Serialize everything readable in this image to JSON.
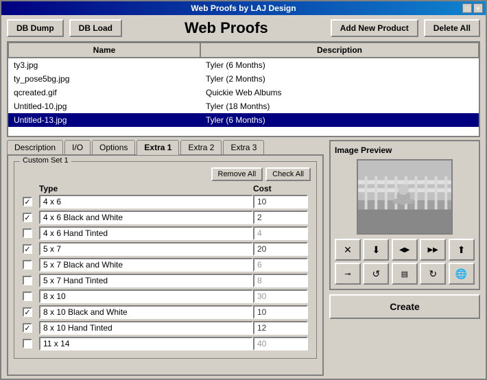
{
  "window": {
    "title": "Web Proofs by LAJ Design",
    "title_btn1": "□",
    "title_btn2": "×"
  },
  "toolbar": {
    "db_dump_label": "DB Dump",
    "db_load_label": "DB Load",
    "title": "Web Proofs",
    "add_new_product_label": "Add New Product",
    "delete_all_label": "Delete All"
  },
  "table": {
    "col_name": "Name",
    "col_description": "Description",
    "rows": [
      {
        "name": "ty3.jpg",
        "description": "Tyler (6 Months)",
        "selected": false
      },
      {
        "name": "ty_pose5bg.jpg",
        "description": "Tyler (2 Months)",
        "selected": false
      },
      {
        "name": "qcreated.gif",
        "description": "Quickie Web Albums",
        "selected": false
      },
      {
        "name": "Untitled-10.jpg",
        "description": "Tyler (18 Months)",
        "selected": false
      },
      {
        "name": "Untitled-13.jpg",
        "description": "Tyler (6 Months)",
        "selected": true
      }
    ]
  },
  "tabs": {
    "items": [
      "Description",
      "I/O",
      "Options",
      "Extra 1",
      "Extra 2",
      "Extra 3"
    ],
    "active": "Extra 1"
  },
  "panel": {
    "custom_set_title": "Custom Set 1",
    "remove_all_label": "Remove All",
    "check_all_label": "Check All",
    "col_type": "Type",
    "col_cost": "Cost",
    "products": [
      {
        "checked": true,
        "name": "4 x 6",
        "cost": "10",
        "greyed": false
      },
      {
        "checked": true,
        "name": "4 x 6 Black and White",
        "cost": "2",
        "greyed": false
      },
      {
        "checked": false,
        "name": "4 x 6 Hand Tinted",
        "cost": "4",
        "greyed": true
      },
      {
        "checked": true,
        "name": "5 x 7",
        "cost": "20",
        "greyed": false
      },
      {
        "checked": false,
        "name": "5 x 7 Black and White",
        "cost": "6",
        "greyed": true
      },
      {
        "checked": false,
        "name": "5 x 7 Hand Tinted",
        "cost": "8",
        "greyed": true
      },
      {
        "checked": false,
        "name": "8 x 10",
        "cost": "30",
        "greyed": true
      },
      {
        "checked": true,
        "name": "8 x 10 Black and White",
        "cost": "10",
        "greyed": false
      },
      {
        "checked": true,
        "name": "8 x 10 Hand Tinted",
        "cost": "12",
        "greyed": false
      },
      {
        "checked": false,
        "name": "11 x 14",
        "cost": "40",
        "greyed": true
      }
    ]
  },
  "image_preview": {
    "title": "Image Preview"
  },
  "icons": {
    "row1": [
      "✕",
      "↓",
      "◁▷",
      "▷▷",
      "↑"
    ],
    "row2": [
      "⊸",
      "↺",
      "≡",
      "↻",
      "🌐"
    ]
  },
  "create_btn": "Create"
}
